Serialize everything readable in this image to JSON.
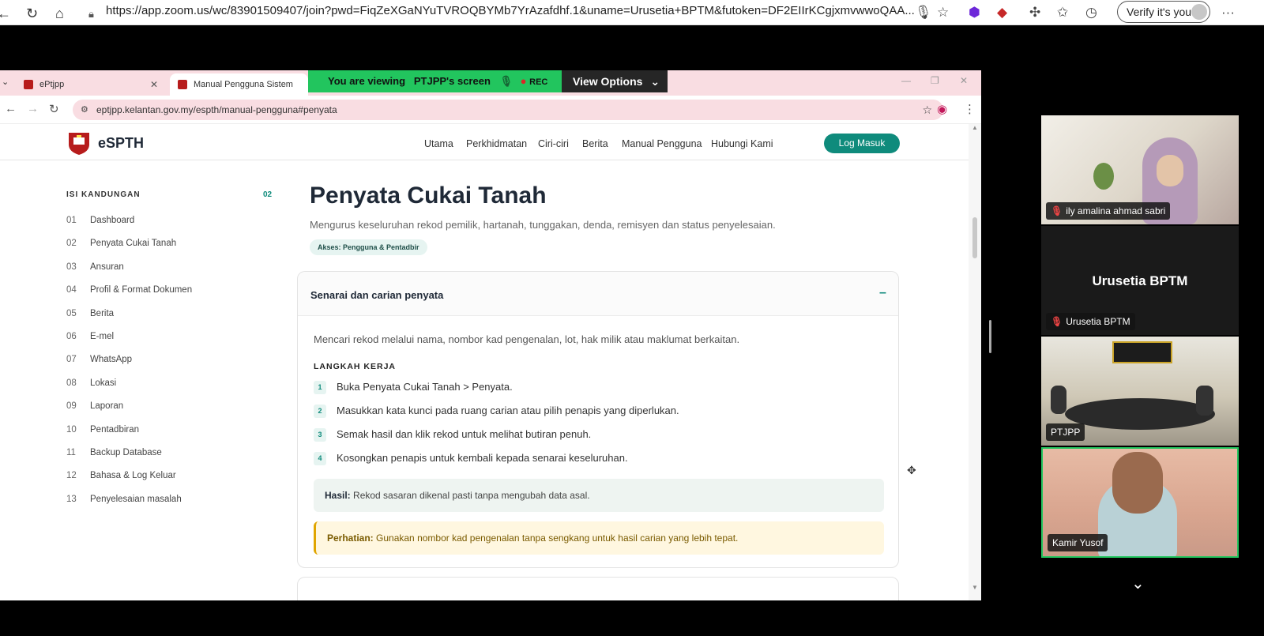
{
  "outer_browser": {
    "url": "https://app.zoom.us/wc/83901509407/join?pwd=FiqZeXGaNYuTVROQBYMb7YrAzafdhf.1&uname=Urusetia+BPTM&futoken=DF2EIIrKCgjxmvwwoQAA...",
    "verify_label": "Verify it's you",
    "icons": [
      "back-icon",
      "refresh-icon",
      "home-icon",
      "lock-icon",
      "mic-icon",
      "favorite-icon",
      "extension-icon",
      "collections-icon",
      "history-icon",
      "more-icon"
    ]
  },
  "zoom": {
    "banner_prefix": "You are viewing",
    "banner_name": "PTJPP's screen",
    "rec": "REC",
    "view_options": "View Options",
    "banner_color": "#22c55e"
  },
  "inner_browser": {
    "tab1": "ePtjpp",
    "tab2": "Manual Pengguna Sistem SPTH",
    "url": "eptjpp.kelantan.gov.my/espth/manual-pengguna#penyata"
  },
  "site": {
    "brand": "eSPTH",
    "nav": [
      "Utama",
      "Perkhidmatan",
      "Ciri-ciri",
      "Berita",
      "Manual Pengguna",
      "Hubungi Kami"
    ],
    "login": "Log Masuk",
    "accent": "#0f8b7c"
  },
  "toc": {
    "title": "ISI KANDUNGAN",
    "active": "02",
    "items": [
      {
        "num": "01",
        "label": "Dashboard"
      },
      {
        "num": "02",
        "label": "Penyata Cukai Tanah"
      },
      {
        "num": "03",
        "label": "Ansuran"
      },
      {
        "num": "04",
        "label": "Profil & Format Dokumen"
      },
      {
        "num": "05",
        "label": "Berita"
      },
      {
        "num": "06",
        "label": "E-mel"
      },
      {
        "num": "07",
        "label": "WhatsApp"
      },
      {
        "num": "08",
        "label": "Lokasi"
      },
      {
        "num": "09",
        "label": "Laporan"
      },
      {
        "num": "10",
        "label": "Pentadbiran"
      },
      {
        "num": "11",
        "label": "Backup Database"
      },
      {
        "num": "12",
        "label": "Bahasa & Log Keluar"
      },
      {
        "num": "13",
        "label": "Penyelesaian masalah"
      }
    ]
  },
  "content": {
    "title": "Penyata Cukai Tanah",
    "subtitle": "Mengurus keseluruhan rekod pemilik, hartanah, tunggakan, denda, remisyen dan status penyelesaian.",
    "access": "Akses: Pengguna & Pentadbir",
    "card": {
      "title": "Senarai dan carian penyata",
      "collapse": "–",
      "description": "Mencari rekod melalui nama, nombor kad pengenalan, lot, hak milik atau maklumat berkaitan.",
      "steps_title": "LANGKAH KERJA",
      "steps": [
        {
          "n": "1",
          "text": "Buka Penyata Cukai Tanah > Penyata."
        },
        {
          "n": "2",
          "text": "Masukkan kata kunci pada ruang carian atau pilih penapis yang diperlukan."
        },
        {
          "n": "3",
          "text": "Semak hasil dan klik rekod untuk melihat butiran penuh."
        },
        {
          "n": "4",
          "text": "Kosongkan penapis untuk kembali kepada senarai keseluruhan."
        }
      ],
      "result_label": "Hasil:",
      "result_text": "Rekod sasaran dikenal pasti tanpa mengubah data asal.",
      "warn_label": "Perhatian:",
      "warn_text": "Gunakan nombor kad pengenalan tanpa sengkang untuk hasil carian yang lebih tepat."
    }
  },
  "participants": [
    {
      "name": "ily amalina ahmad sabri",
      "muted": true
    },
    {
      "name": "Urusetia BPTM",
      "muted": true
    },
    {
      "name": "PTJPP",
      "muted": false
    },
    {
      "name": "Kamir Yusof",
      "muted": false,
      "active_speaker": true
    }
  ]
}
